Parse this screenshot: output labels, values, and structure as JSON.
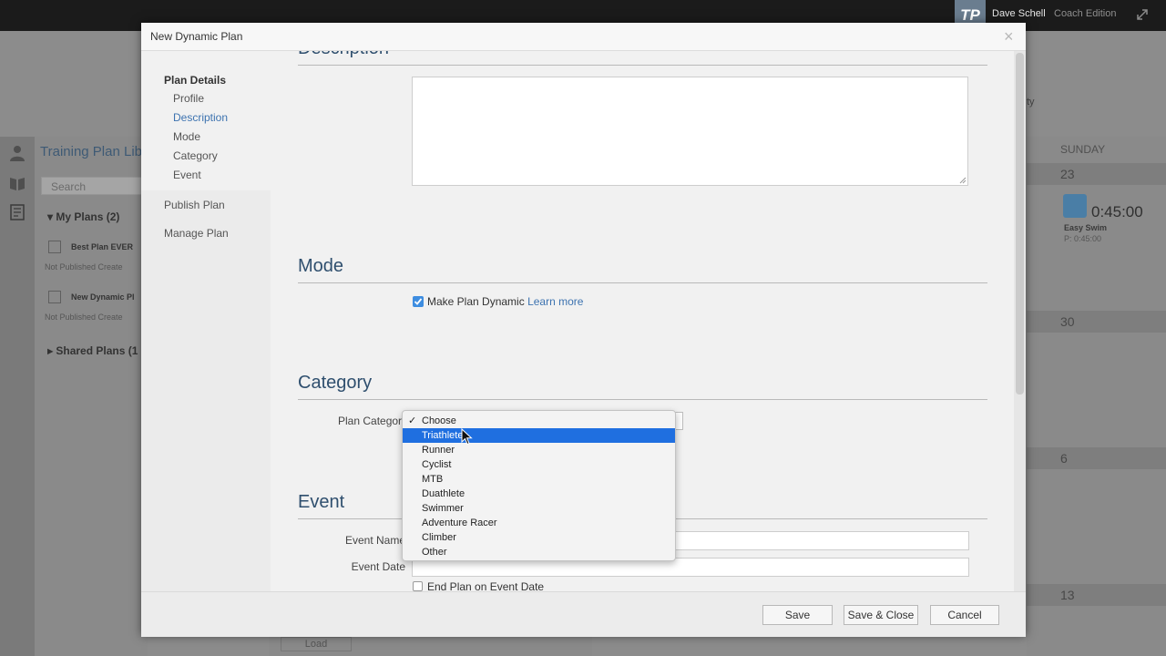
{
  "app": {
    "user_name": "Dave Schell",
    "edition": "Coach Edition",
    "logo_text": "TP"
  },
  "background": {
    "library_title": "Training Plan Lib",
    "search_placeholder": "Search",
    "my_plans": "My Plans (2)",
    "plans": [
      {
        "name": "Best Plan EVER",
        "meta": "Not Published   Create"
      },
      {
        "name": "New Dynamic Pl",
        "meta": "Not Published   Create"
      }
    ],
    "shared_plans": "Shared Plans (1",
    "right_fragment": "ty",
    "calendar_day": "SUNDAY",
    "dates": [
      "23",
      "30",
      "6",
      "13"
    ],
    "workout": {
      "duration": "0:45:00",
      "name": "Easy Swim",
      "planned": "P: 0:45:00"
    },
    "load_label": "Load"
  },
  "modal": {
    "title": "New Dynamic Plan",
    "close_symbol": "×",
    "sidebar": {
      "plan_details": "Plan Details",
      "subitems": [
        "Profile",
        "Description",
        "Mode",
        "Category",
        "Event"
      ],
      "publish": "Publish Plan",
      "manage": "Manage Plan"
    },
    "sections": {
      "description": "Description",
      "mode": "Mode",
      "category": "Category",
      "event": "Event"
    },
    "mode": {
      "checkbox_label": "Make Plan Dynamic",
      "learn_more": "Learn more",
      "checked": true
    },
    "category": {
      "label": "Plan Category",
      "selected": "Choose",
      "highlighted": "Triathlete",
      "options": [
        "Choose",
        "Triathlete",
        "Runner",
        "Cyclist",
        "MTB",
        "Duathlete",
        "Swimmer",
        "Adventure Racer",
        "Climber",
        "Other"
      ]
    },
    "event": {
      "name_label": "Event Name",
      "date_label": "Event Date",
      "end_label": "End Plan on Event Date",
      "end_checked": false
    },
    "footer": {
      "save": "Save",
      "save_close": "Save & Close",
      "cancel": "Cancel"
    }
  },
  "colors": {
    "accent": "#3d73b0",
    "highlight": "#1f6fe0",
    "section_title": "#2f4f6e"
  }
}
